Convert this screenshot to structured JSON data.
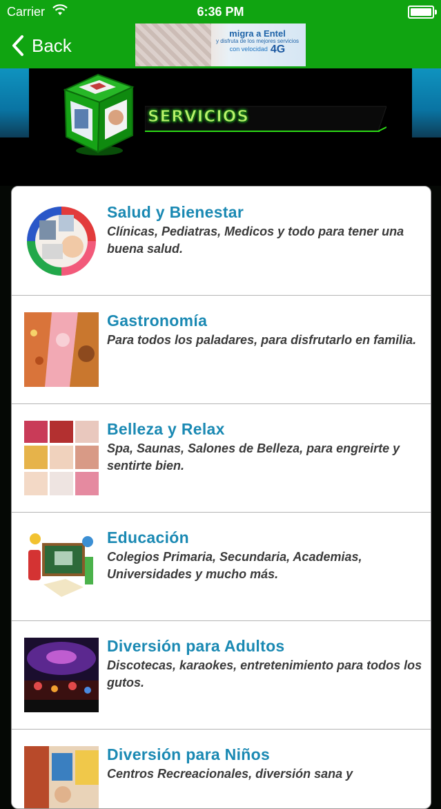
{
  "status_bar": {
    "carrier": "Carrier",
    "time": "6:36 PM"
  },
  "nav": {
    "back_label": "Back"
  },
  "ad": {
    "line1": "migra a Entel",
    "line2": "y disfruta de los mejores servicios",
    "line3": "con velocidad",
    "badge": "4G"
  },
  "header": {
    "title": "SERVICIOS"
  },
  "categories": [
    {
      "title": "Salud y Bienestar",
      "description": "Clínicas, Pediatras, Medicos y todo para tener una buena salud."
    },
    {
      "title": "Gastronomía",
      "description": "Para todos los paladares, para disfrutarlo en familia."
    },
    {
      "title": "Belleza y Relax",
      "description": "Spa, Saunas, Salones de Belleza, para engreirte y sentirte bien."
    },
    {
      "title": "Educación",
      "description": "Colegios Primaria, Secundaria, Academias, Universidades y mucho más."
    },
    {
      "title": "Diversión para Adultos",
      "description": "Discotecas, karaokes, entretenimiento para todos los gutos."
    },
    {
      "title": "Diversión para Niños",
      "description": "Centros Recreacionales, diversión sana y"
    }
  ],
  "colors": {
    "nav_green": "#10a411",
    "title_blue": "#1a89b3",
    "desc_text": "#3a3a3a"
  },
  "icons": [
    "wifi-icon",
    "battery-icon",
    "chevron-left-icon",
    "logo-cube-icon"
  ]
}
